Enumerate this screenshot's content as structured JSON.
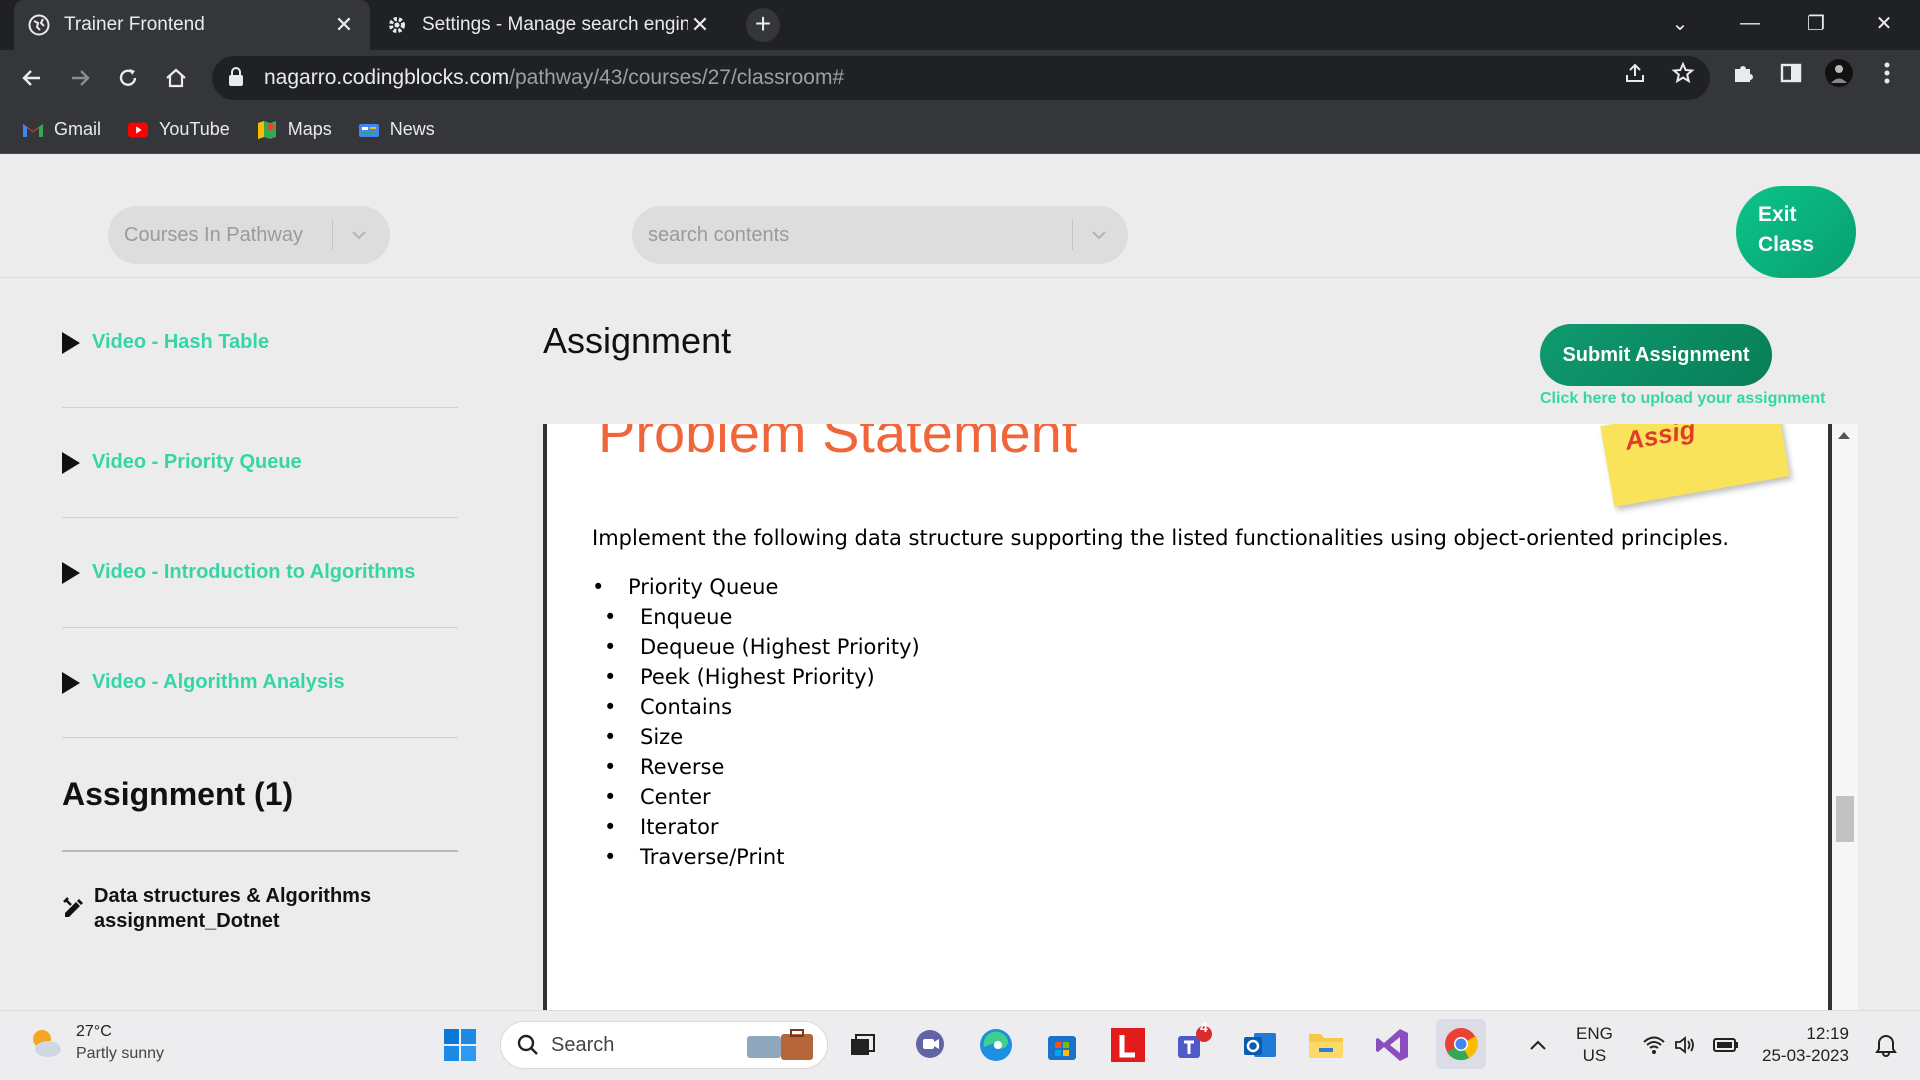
{
  "browser": {
    "tabs": [
      {
        "title": "Trainer Frontend",
        "active": true
      },
      {
        "title": "Settings - Manage search engine",
        "active": false
      }
    ],
    "url_host": "nagarro.codingblocks.com",
    "url_path": "/pathway/43/courses/27/classroom#",
    "bookmarks": [
      "Gmail",
      "YouTube",
      "Maps",
      "News"
    ]
  },
  "topbar": {
    "courses_dropdown": "Courses In Pathway",
    "search_placeholder": "search contents",
    "exit_line1": "Exit",
    "exit_line2": "Class"
  },
  "sidebar": {
    "items": [
      {
        "label": "Video - Hash Table"
      },
      {
        "label": "Video - Priority Queue"
      },
      {
        "label": "Video - Introduction to Algorithms"
      },
      {
        "label": "Video - Algorithm Analysis"
      }
    ],
    "assignment_heading": "Assignment (1)",
    "assignment_item_line1": "Data structures & Algorithms",
    "assignment_item_line2": "assignment_Dotnet"
  },
  "main": {
    "title": "Assignment",
    "submit_label": "Submit Assignment",
    "submit_hint": "Click here to upload your assignment"
  },
  "document": {
    "heading": "Problem Statement",
    "sticky_text": "Assig",
    "intro": "Implement the following data structure supporting the listed functionalities using object-oriented principles.",
    "list_title": "Priority Queue",
    "items": [
      "Enqueue",
      "Dequeue (Highest Priority)",
      "Peek (Highest Priority)",
      "Contains",
      "Size",
      "Reverse",
      "Center",
      "Iterator",
      "Traverse/Print"
    ]
  },
  "taskbar": {
    "weather_temp": "27°C",
    "weather_desc": "Partly sunny",
    "search_label": "Search",
    "teams_badge": "4",
    "lang_line1": "ENG",
    "lang_line2": "US",
    "time": "12:19",
    "date": "25-03-2023"
  },
  "colors": {
    "accent_green": "#35d6a6",
    "button_green": "#0b9b6e",
    "heading_orange": "#f0663a"
  }
}
